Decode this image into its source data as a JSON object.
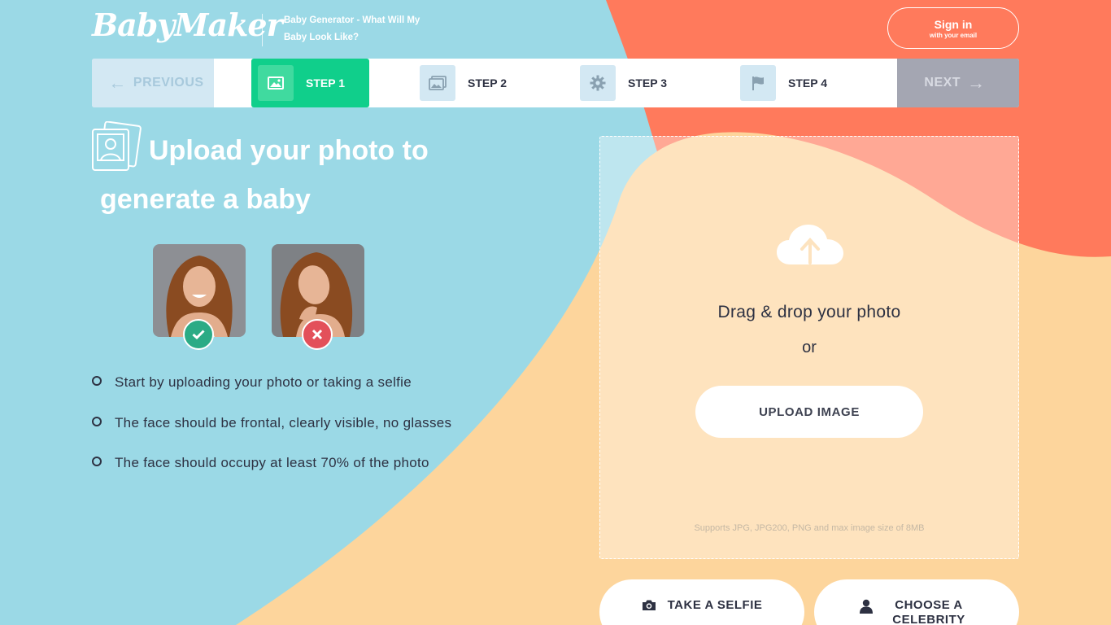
{
  "header": {
    "logo": "BabyMaker",
    "tagline": "Baby Generator - What Will My Baby Look Like?",
    "signin": {
      "label": "Sign in",
      "sub": "with your email"
    }
  },
  "stepper": {
    "previous": "PREVIOUS",
    "next": "NEXT",
    "steps": [
      {
        "label": "STEP 1",
        "icon": "image-icon",
        "active": true
      },
      {
        "label": "STEP 2",
        "icon": "images-icon",
        "active": false
      },
      {
        "label": "STEP 3",
        "icon": "gear-icon",
        "active": false
      },
      {
        "label": "STEP 4",
        "icon": "flag-icon",
        "active": false
      }
    ]
  },
  "main": {
    "title": "Upload your photo to generate a baby",
    "tips": [
      "Start by uploading your photo or taking a selfie",
      "The face should be frontal, clearly visible, no glasses",
      "The face should occupy at least 70% of the photo"
    ]
  },
  "upload": {
    "drag_text": "Drag & drop your photo",
    "or_text": "or",
    "button": "UPLOAD IMAGE",
    "supports": "Supports JPG, JPG200, PNG and max image size of 8MB"
  },
  "actions": {
    "selfie": "TAKE A SELFIE",
    "celebrity": "CHOOSE A CELEBRITY"
  },
  "colors": {
    "sky": "#9bd9e6",
    "coral": "#ff7a5c",
    "peach": "#fdd59c",
    "green": "#10cf8b",
    "red": "#e3505a",
    "teal_check": "#2bab85"
  }
}
